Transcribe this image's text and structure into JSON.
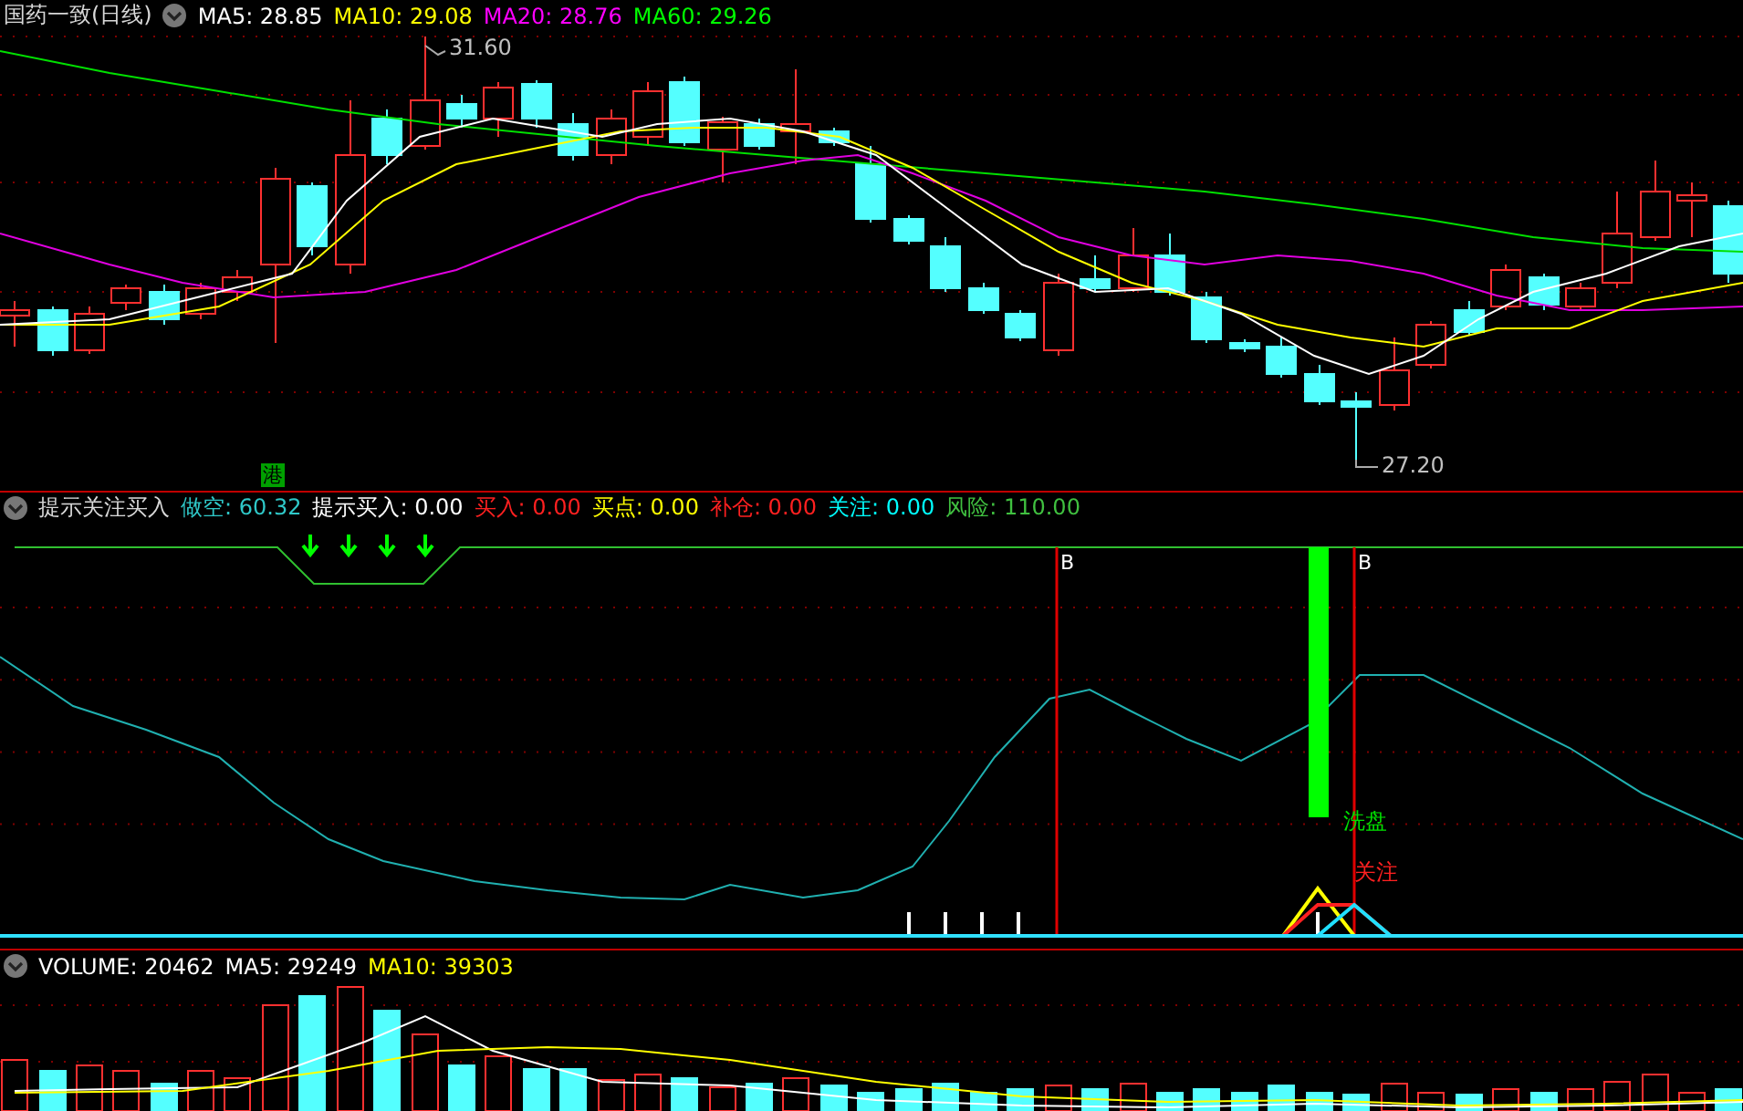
{
  "price_panel": {
    "title": "国药一致(日线)",
    "legend": [
      {
        "label": "MA5: 28.85",
        "color": "#ffffff"
      },
      {
        "label": "MA10: 29.08",
        "color": "#ffff00"
      },
      {
        "label": "MA20: 28.76",
        "color": "#ff00ff"
      },
      {
        "label": "MA60: 29.26",
        "color": "#00ff00"
      }
    ],
    "high_label": "31.60",
    "low_label": "27.20",
    "badge": "港"
  },
  "indicator_panel": {
    "title": "提示关注买入",
    "legend": [
      {
        "label": "做空: 60.32",
        "color": "#2fc8c8"
      },
      {
        "label": "提示买入: 0.00",
        "color": "#ffffff"
      },
      {
        "label": "买入: 0.00",
        "color": "#ff2020"
      },
      {
        "label": "买点: 0.00",
        "color": "#ffff00"
      },
      {
        "label": "补仓: 0.00",
        "color": "#ff2020"
      },
      {
        "label": "关注: 0.00",
        "color": "#00ffff"
      },
      {
        "label": "风险: 110.00",
        "color": "#40c040"
      }
    ],
    "signal_labels": [
      "B",
      "B"
    ],
    "wash_label": "洗盘",
    "watch_label": "关注"
  },
  "volume_panel": {
    "legend": [
      {
        "label": "VOLUME: 20462",
        "color": "#ffffff"
      },
      {
        "label": "MA5: 29249",
        "color": "#ffffff"
      },
      {
        "label": "MA10: 39303",
        "color": "#ffff00"
      }
    ]
  }
}
